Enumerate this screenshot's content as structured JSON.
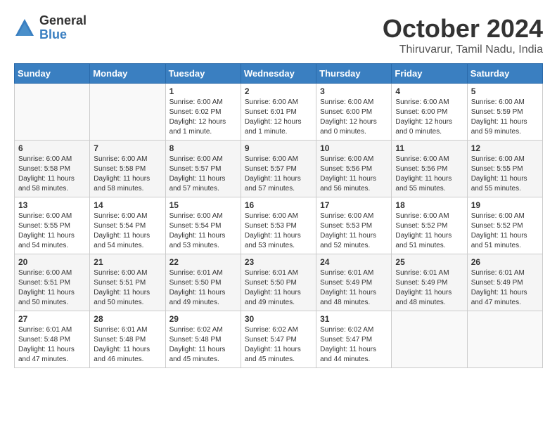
{
  "header": {
    "logo_general": "General",
    "logo_blue": "Blue",
    "title": "October 2024",
    "location": "Thiruvarur, Tamil Nadu, India"
  },
  "days_of_week": [
    "Sunday",
    "Monday",
    "Tuesday",
    "Wednesday",
    "Thursday",
    "Friday",
    "Saturday"
  ],
  "weeks": [
    [
      {
        "day": "",
        "info": ""
      },
      {
        "day": "",
        "info": ""
      },
      {
        "day": "1",
        "info": "Sunrise: 6:00 AM\nSunset: 6:02 PM\nDaylight: 12 hours\nand 1 minute."
      },
      {
        "day": "2",
        "info": "Sunrise: 6:00 AM\nSunset: 6:01 PM\nDaylight: 12 hours\nand 1 minute."
      },
      {
        "day": "3",
        "info": "Sunrise: 6:00 AM\nSunset: 6:00 PM\nDaylight: 12 hours\nand 0 minutes."
      },
      {
        "day": "4",
        "info": "Sunrise: 6:00 AM\nSunset: 6:00 PM\nDaylight: 12 hours\nand 0 minutes."
      },
      {
        "day": "5",
        "info": "Sunrise: 6:00 AM\nSunset: 5:59 PM\nDaylight: 11 hours\nand 59 minutes."
      }
    ],
    [
      {
        "day": "6",
        "info": "Sunrise: 6:00 AM\nSunset: 5:58 PM\nDaylight: 11 hours\nand 58 minutes."
      },
      {
        "day": "7",
        "info": "Sunrise: 6:00 AM\nSunset: 5:58 PM\nDaylight: 11 hours\nand 58 minutes."
      },
      {
        "day": "8",
        "info": "Sunrise: 6:00 AM\nSunset: 5:57 PM\nDaylight: 11 hours\nand 57 minutes."
      },
      {
        "day": "9",
        "info": "Sunrise: 6:00 AM\nSunset: 5:57 PM\nDaylight: 11 hours\nand 57 minutes."
      },
      {
        "day": "10",
        "info": "Sunrise: 6:00 AM\nSunset: 5:56 PM\nDaylight: 11 hours\nand 56 minutes."
      },
      {
        "day": "11",
        "info": "Sunrise: 6:00 AM\nSunset: 5:56 PM\nDaylight: 11 hours\nand 55 minutes."
      },
      {
        "day": "12",
        "info": "Sunrise: 6:00 AM\nSunset: 5:55 PM\nDaylight: 11 hours\nand 55 minutes."
      }
    ],
    [
      {
        "day": "13",
        "info": "Sunrise: 6:00 AM\nSunset: 5:55 PM\nDaylight: 11 hours\nand 54 minutes."
      },
      {
        "day": "14",
        "info": "Sunrise: 6:00 AM\nSunset: 5:54 PM\nDaylight: 11 hours\nand 54 minutes."
      },
      {
        "day": "15",
        "info": "Sunrise: 6:00 AM\nSunset: 5:54 PM\nDaylight: 11 hours\nand 53 minutes."
      },
      {
        "day": "16",
        "info": "Sunrise: 6:00 AM\nSunset: 5:53 PM\nDaylight: 11 hours\nand 53 minutes."
      },
      {
        "day": "17",
        "info": "Sunrise: 6:00 AM\nSunset: 5:53 PM\nDaylight: 11 hours\nand 52 minutes."
      },
      {
        "day": "18",
        "info": "Sunrise: 6:00 AM\nSunset: 5:52 PM\nDaylight: 11 hours\nand 51 minutes."
      },
      {
        "day": "19",
        "info": "Sunrise: 6:00 AM\nSunset: 5:52 PM\nDaylight: 11 hours\nand 51 minutes."
      }
    ],
    [
      {
        "day": "20",
        "info": "Sunrise: 6:00 AM\nSunset: 5:51 PM\nDaylight: 11 hours\nand 50 minutes."
      },
      {
        "day": "21",
        "info": "Sunrise: 6:00 AM\nSunset: 5:51 PM\nDaylight: 11 hours\nand 50 minutes."
      },
      {
        "day": "22",
        "info": "Sunrise: 6:01 AM\nSunset: 5:50 PM\nDaylight: 11 hours\nand 49 minutes."
      },
      {
        "day": "23",
        "info": "Sunrise: 6:01 AM\nSunset: 5:50 PM\nDaylight: 11 hours\nand 49 minutes."
      },
      {
        "day": "24",
        "info": "Sunrise: 6:01 AM\nSunset: 5:49 PM\nDaylight: 11 hours\nand 48 minutes."
      },
      {
        "day": "25",
        "info": "Sunrise: 6:01 AM\nSunset: 5:49 PM\nDaylight: 11 hours\nand 48 minutes."
      },
      {
        "day": "26",
        "info": "Sunrise: 6:01 AM\nSunset: 5:49 PM\nDaylight: 11 hours\nand 47 minutes."
      }
    ],
    [
      {
        "day": "27",
        "info": "Sunrise: 6:01 AM\nSunset: 5:48 PM\nDaylight: 11 hours\nand 47 minutes."
      },
      {
        "day": "28",
        "info": "Sunrise: 6:01 AM\nSunset: 5:48 PM\nDaylight: 11 hours\nand 46 minutes."
      },
      {
        "day": "29",
        "info": "Sunrise: 6:02 AM\nSunset: 5:48 PM\nDaylight: 11 hours\nand 45 minutes."
      },
      {
        "day": "30",
        "info": "Sunrise: 6:02 AM\nSunset: 5:47 PM\nDaylight: 11 hours\nand 45 minutes."
      },
      {
        "day": "31",
        "info": "Sunrise: 6:02 AM\nSunset: 5:47 PM\nDaylight: 11 hours\nand 44 minutes."
      },
      {
        "day": "",
        "info": ""
      },
      {
        "day": "",
        "info": ""
      }
    ]
  ]
}
